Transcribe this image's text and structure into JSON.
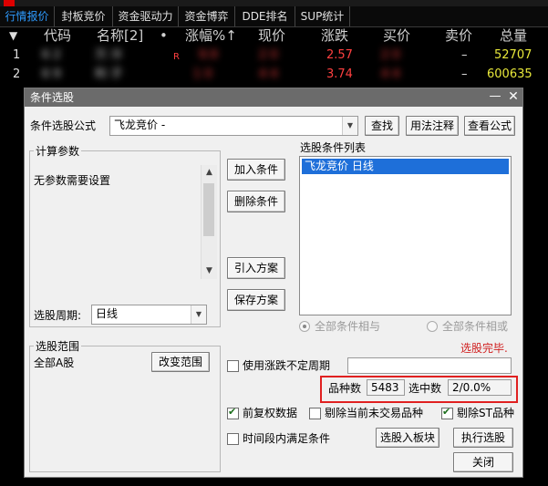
{
  "app": {
    "tabs": [
      "行情报价",
      "封板竞价",
      "资金驱动力",
      "资金博弈",
      "DDE排名",
      "SUP统计"
    ],
    "columns": [
      "代码",
      "名称[2]",
      "•",
      "涨幅%↑",
      "现价",
      "涨跌",
      "买价",
      "卖价",
      "总量"
    ],
    "rows": [
      {
        "no": "1",
        "code": "6   2",
        "name": "万    冷",
        "flag": "R",
        "pct": "9.9",
        "price": "2  0",
        "change": "2.57",
        "bid": "2  0",
        "ask": "–",
        "vol": "52707"
      },
      {
        "no": "2",
        "code": "6   9",
        "name": "利    子",
        "flag": "",
        "pct": "1  0",
        "price": "4   4",
        "change": "3.74",
        "bid": "4   4",
        "ask": "–",
        "vol": "600635"
      }
    ]
  },
  "dialog": {
    "title": "条件选股",
    "formula_label": "条件选股公式",
    "formula_value": "飞龙竞价 -",
    "find_btn": "查找",
    "usage_btn": "用法注释",
    "view_formula_btn": "查看公式",
    "params_group": "计算参数",
    "params_text": "无参数需要设置",
    "period_label": "选股周期:",
    "period_value": "日线",
    "add_cond_btn": "加入条件",
    "del_cond_btn": "删除条件",
    "import_plan_btn": "引入方案",
    "save_plan_btn": "保存方案",
    "cond_list_label": "选股条件列表",
    "cond_list_items": [
      "飞龙竞价 日线"
    ],
    "radio_and": "全部条件相与",
    "radio_or": "全部条件相或",
    "status": "选股完毕.",
    "range_group": "选股范围",
    "range_value": "全部A股",
    "change_range_btn": "改变范围",
    "use_irregular_label": "使用涨跌不定周期",
    "count_label": "品种数",
    "count_value": "5483",
    "selected_label": "选中数",
    "selected_value": "2/0.0%",
    "prerights_label": "前复权数据",
    "exclude_untraded_label": "剔除当前未交易品种",
    "exclude_st_label": "剔除ST品种",
    "time_satisfy_label": "时间段内满足条件",
    "to_block_btn": "选股入板块",
    "execute_btn": "执行选股",
    "close_btn": "关闭"
  },
  "colors": {
    "highlight_box": "#e02020",
    "selection": "#1e6fd9",
    "dialog_titlebar": "#6b6b6b"
  }
}
